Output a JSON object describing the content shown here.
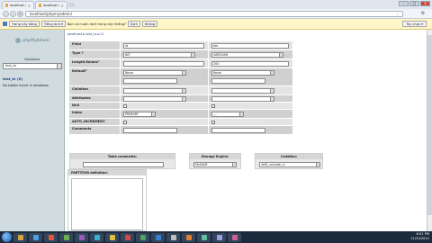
{
  "browser": {
    "tabs": [
      {
        "label": "localhost / localhost / test_..."
      },
      {
        "label": "localhost / localhost / test_..."
      }
    ],
    "url": "localhost/phpmyadmin/",
    "window_controls": [
      "–",
      "□",
      "✕"
    ]
  },
  "translate_bar": {
    "btn_translate": "Trang này bằng",
    "btn_language": "Tiếng Anh ▾",
    "prompt": "Bạn có muốn dịch trang này không?",
    "btn_yes": "Dịch",
    "btn_no": "Không",
    "btn_options": "Tùy chọn ▾"
  },
  "left": {
    "logo": "phpMyAdmin",
    "db_heading": "Database",
    "db_select": "test_tv",
    "db_link": "test_tv (0)",
    "no_tables": "No tables found in database."
  },
  "main": {
    "breadcrumb": "localhost ▸ test_tv ▸ t1",
    "rows": [
      {
        "label": "Field",
        "c1": "id",
        "c2": "ten"
      },
      {
        "label": "Type ?",
        "c1": "INT",
        "c2": "VARCHAR"
      },
      {
        "label": "Length/Values¹",
        "c1": "",
        "c2": "200"
      },
      {
        "label": "Default²",
        "c1": "None",
        "c2": "None"
      },
      {
        "label": "Collation",
        "c1": "",
        "c2": ""
      },
      {
        "label": "Attributes",
        "c1": "",
        "c2": ""
      },
      {
        "label": "Null",
        "c1": "",
        "c2": ""
      },
      {
        "label": "Index",
        "c1": "PRIMARY",
        "c2": "---"
      },
      {
        "label": "AUTO_INCREMENT",
        "c1": "",
        "c2": ""
      },
      {
        "label": "Comments",
        "c1": "",
        "c2": ""
      }
    ],
    "table_comments": "Table comments:",
    "storage_engine": "Storage Engine:",
    "storage_engine_value": "MyISAM",
    "collation": "Collation:",
    "collation_value": "utf8_unicode_ci",
    "partition": "PARTITION definition:"
  },
  "taskbar": {
    "time": "6:01 PM",
    "date": "11/20/2012",
    "icon_colors": [
      "#d9a33b",
      "#4aa0e0",
      "#e05a3a",
      "#6ab04c",
      "#9b59b6",
      "#3cb0c8",
      "#e0c040",
      "#d04848",
      "#50a060",
      "#3a7fd0",
      "#c0c0c0",
      "#e08030",
      "#60c0a0",
      "#a0a0e0",
      "#d06090"
    ]
  }
}
